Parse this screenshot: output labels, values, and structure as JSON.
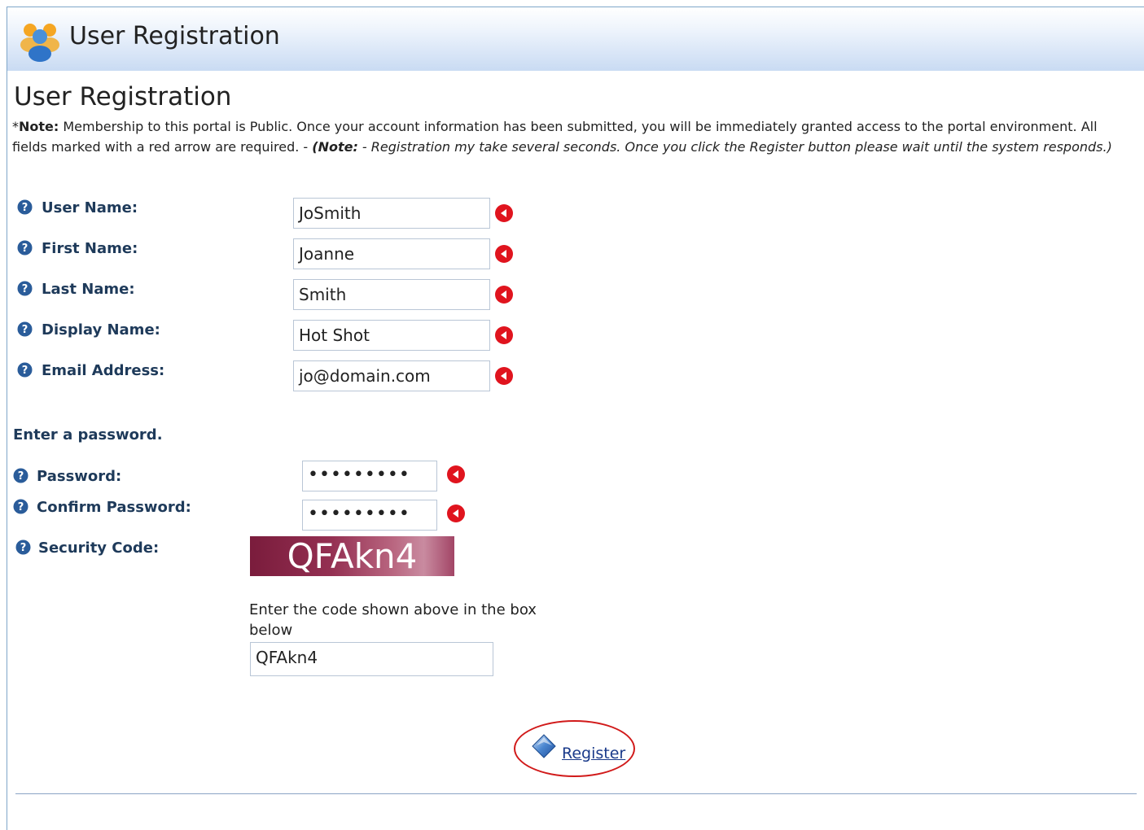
{
  "window": {
    "title": "User Registration"
  },
  "page": {
    "heading": "User Registration",
    "note": {
      "prefix": "*",
      "label": "Note:",
      "text": " Membership to this portal is Public. Once your account information has been submitted, you will be immediately granted access to the portal environment. All fields marked with a red arrow are required. - ",
      "paren_open": "(",
      "italic_label": "Note:",
      "italic_text": " - Registration my take several seconds. Once you click the Register button please wait until the system responds.)"
    }
  },
  "fields": [
    {
      "label": "User Name:",
      "value": "JoSmith"
    },
    {
      "label": "First Name:",
      "value": "Joanne"
    },
    {
      "label": "Last Name:",
      "value": "Smith"
    },
    {
      "label": "Display Name:",
      "value": "Hot Shot"
    },
    {
      "label": "Email Address:",
      "value": "jo@domain.com"
    }
  ],
  "password_section": {
    "heading": "Enter a password.",
    "password_label": "Password:",
    "password_value": "•••••••••",
    "confirm_label": "Confirm Password:",
    "confirm_value": "•••••••••"
  },
  "security": {
    "label": "Security Code:",
    "captcha_text": "QFAkn4",
    "help_text": "Enter the code shown above in the box below",
    "input_value": "QFAkn4"
  },
  "actions": {
    "register_label": "Register"
  },
  "colors": {
    "required_arrow": "#e0141e",
    "help_icon": "#2a5c9a",
    "highlight_ring": "#d11a1a"
  },
  "icons": {
    "title": "users-group-icon",
    "help": "help-circle-icon",
    "required": "required-arrow-icon",
    "register": "register-diamond-icon"
  }
}
